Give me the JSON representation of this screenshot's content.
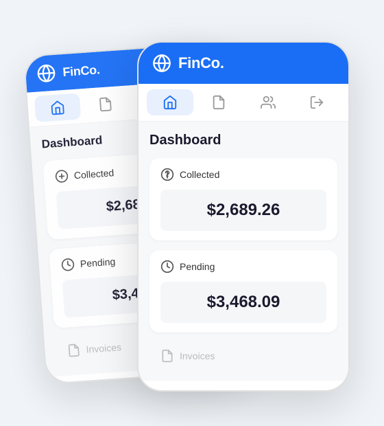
{
  "app": {
    "title": "FinCo.",
    "header_icon": "globe"
  },
  "nav": {
    "items": [
      {
        "id": "home",
        "label": "Home",
        "active": true
      },
      {
        "id": "documents",
        "label": "Documents",
        "active": false
      },
      {
        "id": "users",
        "label": "Users",
        "active": false
      },
      {
        "id": "logout",
        "label": "Logout",
        "active": false
      }
    ]
  },
  "dashboard": {
    "title": "Dashboard",
    "cards": [
      {
        "id": "collected",
        "label": "Collected",
        "value": "$2,689.26",
        "icon": "dollar-circle"
      },
      {
        "id": "pending",
        "label": "Pending",
        "value": "$3,468.09",
        "icon": "clock"
      }
    ],
    "invoices_label": "Invoices"
  },
  "colors": {
    "brand_blue": "#1a6ef5",
    "nav_active_bg": "#e8f0fe",
    "text_dark": "#1a1a2e",
    "text_muted": "#999999",
    "card_bg": "#f5f6f8"
  }
}
